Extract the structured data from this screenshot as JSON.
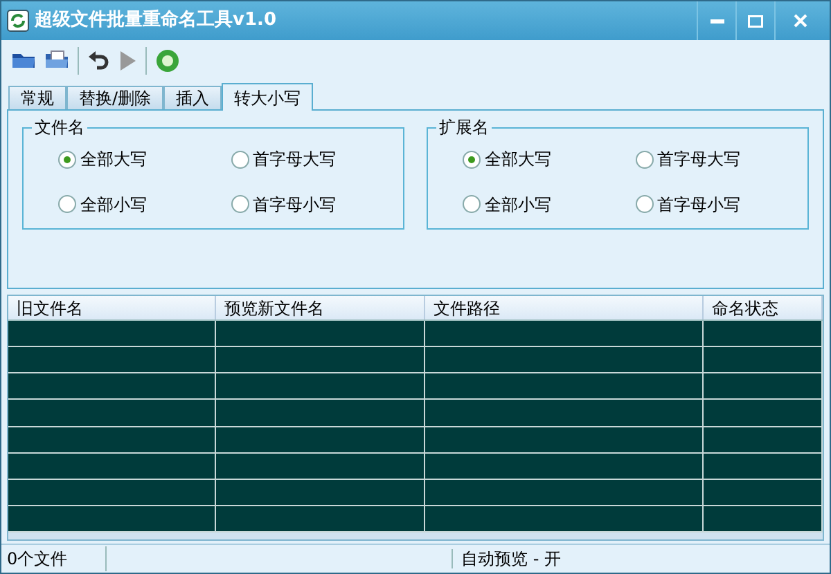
{
  "window": {
    "title": "超级文件批量重命名工具v1.0"
  },
  "tabs": [
    {
      "label": "常规",
      "selected": false
    },
    {
      "label": "替换/删除",
      "selected": false
    },
    {
      "label": "插入",
      "selected": false
    },
    {
      "label": "转大小写",
      "selected": true
    }
  ],
  "groups": [
    {
      "title": "文件名",
      "options": [
        {
          "label": "全部大写",
          "selected": true
        },
        {
          "label": "首字母大写",
          "selected": false
        },
        {
          "label": "全部小写",
          "selected": false
        },
        {
          "label": "首字母小写",
          "selected": false
        }
      ]
    },
    {
      "title": "扩展名",
      "options": [
        {
          "label": "全部大写",
          "selected": true
        },
        {
          "label": "首字母大写",
          "selected": false
        },
        {
          "label": "全部小写",
          "selected": false
        },
        {
          "label": "首字母小写",
          "selected": false
        }
      ]
    }
  ],
  "table": {
    "columns": [
      "旧文件名",
      "预览新文件名",
      "文件路径",
      "命名状态"
    ]
  },
  "status_bar": [
    "0个文件",
    "自动预览 - 开"
  ]
}
